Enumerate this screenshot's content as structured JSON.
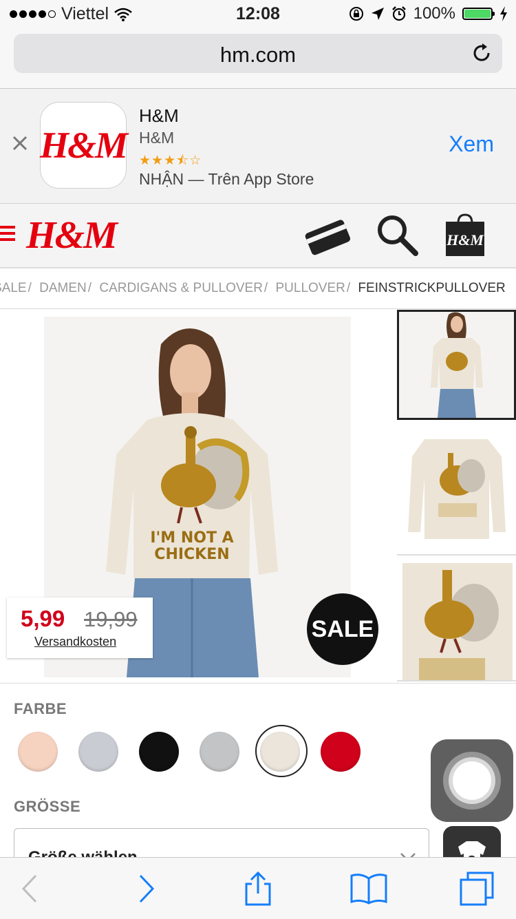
{
  "status_bar": {
    "carrier": "Viettel",
    "time": "12:08",
    "battery": "100%",
    "signal_bars": 4,
    "battery_level": 1.0
  },
  "browser": {
    "url": "hm.com"
  },
  "app_banner": {
    "app_name": "H&M",
    "developer": "H&M",
    "stars": "★★★⯪☆",
    "rating": 3.5,
    "store_text": "NHẬN — Trên App Store",
    "open_label": "Xem",
    "logo_text": "H&M"
  },
  "header": {
    "logo_text": "H&M",
    "bag_logo": "H&M"
  },
  "breadcrumb": [
    {
      "label": "SALE",
      "sep": "/"
    },
    {
      "label": "DAMEN",
      "sep": "/"
    },
    {
      "label": "CARDIGANS & PULLOVER",
      "sep": "/"
    },
    {
      "label": "PULLOVER",
      "sep": "/"
    },
    {
      "label": "FEINSTRICKPULLOVER",
      "sep": ""
    }
  ],
  "product": {
    "price_new": "5,99",
    "price_old": "19,99",
    "shipping_link": "Versandkosten",
    "sale_badge": "SALE",
    "print_line1": "I'M NOT A",
    "print_line2": "CHICKEN"
  },
  "colors": {
    "label": "FARBE",
    "swatches": [
      {
        "name": "peach",
        "hex": "#f6d2c0"
      },
      {
        "name": "light-grey-blue",
        "hex": "#c9ccd2"
      },
      {
        "name": "black",
        "hex": "#111111"
      },
      {
        "name": "grey",
        "hex": "#c3c4c6"
      },
      {
        "name": "cream",
        "hex": "#ece5dc",
        "selected": true
      },
      {
        "name": "red",
        "hex": "#d0021b"
      }
    ]
  },
  "size": {
    "label": "GRÖSSE",
    "placeholder": "Größe wählen"
  },
  "theme": {
    "accent_blue": "#147efb",
    "brand_red": "#e50010"
  },
  "toolbar_icons": [
    "back-icon",
    "forward-icon",
    "share-icon",
    "bookmarks-icon",
    "tabs-icon"
  ]
}
